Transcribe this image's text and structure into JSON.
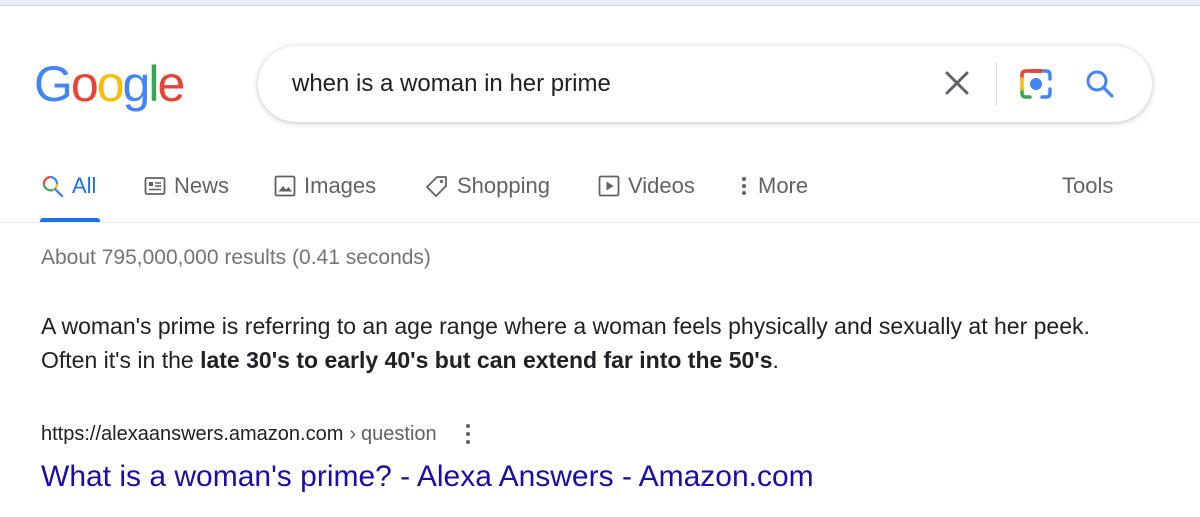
{
  "logo": {
    "letters": [
      "G",
      "o",
      "o",
      "g",
      "l",
      "e"
    ]
  },
  "search": {
    "query": "when is a woman in her prime"
  },
  "tabs": [
    {
      "label": "All",
      "icon": "search-icon"
    },
    {
      "label": "News",
      "icon": "news-icon"
    },
    {
      "label": "Images",
      "icon": "image-icon"
    },
    {
      "label": "Shopping",
      "icon": "tag-icon"
    },
    {
      "label": "Videos",
      "icon": "play-icon"
    },
    {
      "label": "More",
      "icon": "more-vert-icon"
    }
  ],
  "tools_label": "Tools",
  "result_stats": "About 795,000,000 results (0.41 seconds)",
  "featured_snippet": {
    "text_before": "A woman's prime is referring to an age range where a woman feels physically and sexually at her peek. Often it's in the ",
    "bold": "late 30's to early 40's but can extend far into the 50's",
    "text_after": "."
  },
  "result": {
    "cite_url": "https://alexaanswers.amazon.com",
    "cite_separator": "›",
    "cite_path": "question",
    "title": "What is a woman's prime? - Alexa Answers - Amazon.com"
  },
  "colors": {
    "link": "#1a0dab",
    "accent": "#1a73e8",
    "muted": "#70757a"
  }
}
